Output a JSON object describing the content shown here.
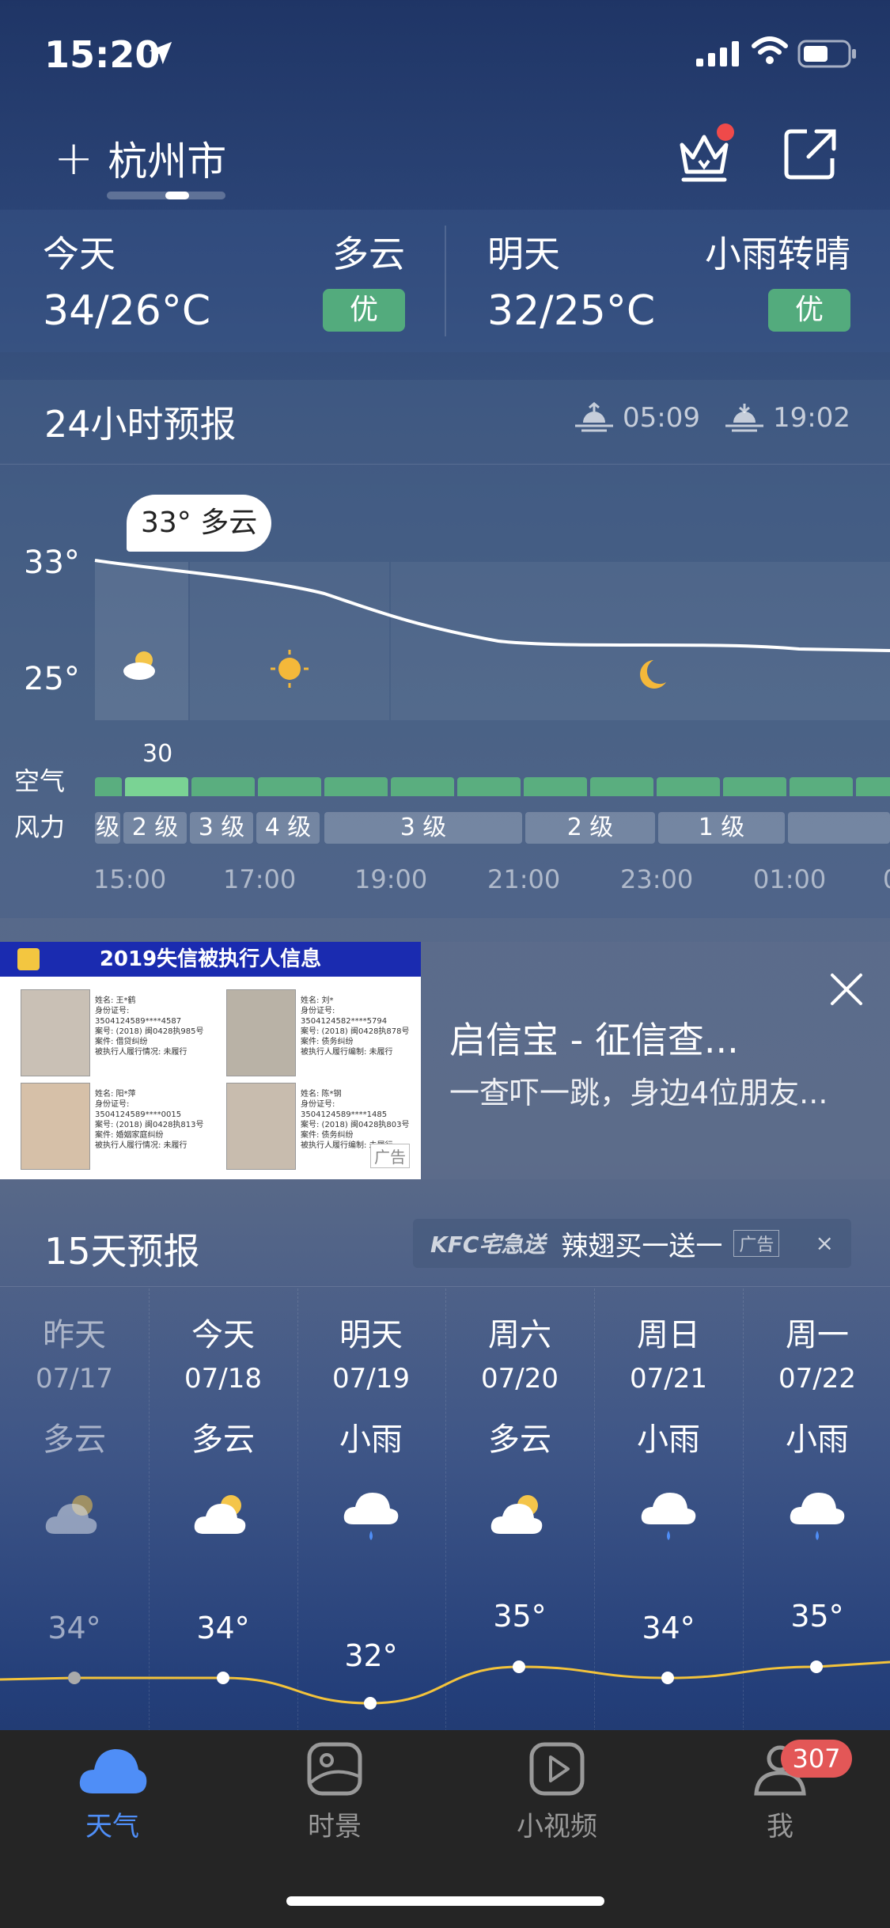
{
  "status": {
    "time": "15:20"
  },
  "header": {
    "city": "杭州市"
  },
  "today": {
    "label": "今天",
    "condition": "多云",
    "temp": "34/26°C",
    "aqi": "优"
  },
  "tomorrow": {
    "label": "明天",
    "condition": "小雨转晴",
    "temp": "32/25°C",
    "aqi": "优"
  },
  "forecast24": {
    "title": "24小时预报",
    "sunrise": "05:09",
    "sunset": "19:02",
    "high": "33°",
    "low": "25°",
    "tooltip": "33° 多云",
    "aqi_label": "空气",
    "wind_label": "风力",
    "aqi_value": "30",
    "winds": [
      "级",
      "2 级",
      "3 级",
      "4 级",
      "3 级",
      "2 级",
      "1 级",
      ""
    ],
    "hours": [
      "15:00",
      "17:00",
      "19:00",
      "21:00",
      "23:00",
      "01:00",
      "0"
    ],
    "colors": {
      "aqi_good": "#5aae7f",
      "aqi_selected": "#7ad394"
    }
  },
  "ad": {
    "image_title": "2019失信被执行人信息",
    "image_tag": "广告",
    "title": "启信宝 - 征信查...",
    "subtitle": "一查吓一跳，身边4位朋友...",
    "persons": [
      {
        "name": "姓名: 王*鹤",
        "id": "身份证号: 3504124589****4587",
        "case": "案号: (2018) 闽0428执985号",
        "type": "案件: 借贷纠纷",
        "status": "被执行人履行情况: 未履行"
      },
      {
        "name": "姓名: 刘*",
        "id": "身份证号: 3504124582****5794",
        "case": "案号: (2018) 闽0428执878号",
        "type": "案件: 债务纠纷",
        "status": "被执行人履行编制: 未履行"
      },
      {
        "name": "姓名: 阳*萍",
        "id": "身份证号: 3504124589****0015",
        "case": "案号: (2018) 闽0428执813号",
        "type": "案件: 婚姻家庭纠纷",
        "status": "被执行人履行情况: 未履行"
      },
      {
        "name": "姓名: 陈*钢",
        "id": "身份证号: 3504124589****1485",
        "case": "案号: (2018) 闽0428执803号",
        "type": "案件: 债务纠纷",
        "status": "被执行人履行编制: 未履行"
      }
    ]
  },
  "forecast15": {
    "title": "15天预报",
    "kfc_logo": "KFC宅急送",
    "kfc_text": "辣翅买一送一",
    "kfc_ad": "广告",
    "kfc_close": "×",
    "days": [
      {
        "wd": "昨天",
        "date": "07/17",
        "cond": "多云",
        "hi": "34°",
        "icon": "partly-cloudy-icon"
      },
      {
        "wd": "今天",
        "date": "07/18",
        "cond": "多云",
        "hi": "34°",
        "icon": "partly-cloudy-icon"
      },
      {
        "wd": "明天",
        "date": "07/19",
        "cond": "小雨",
        "hi": "32°",
        "icon": "rain-icon"
      },
      {
        "wd": "周六",
        "date": "07/20",
        "cond": "多云",
        "hi": "35°",
        "icon": "partly-cloudy-icon"
      },
      {
        "wd": "周日",
        "date": "07/21",
        "cond": "小雨",
        "hi": "34°",
        "icon": "rain-icon"
      },
      {
        "wd": "周一",
        "date": "07/22",
        "cond": "小雨",
        "hi": "35°",
        "icon": "rain-icon"
      }
    ]
  },
  "tabs": [
    {
      "label": "天气",
      "icon": "cloud-icon",
      "active": true
    },
    {
      "label": "时景",
      "icon": "scenery-icon"
    },
    {
      "label": "小视频",
      "icon": "play-icon"
    },
    {
      "label": "我",
      "icon": "user-icon"
    }
  ],
  "badge": "307",
  "colors": {
    "accent": "#4f8ef7",
    "aqi_badge": "#53ab7d",
    "temp_line": "#f3c33b",
    "badge": "#e35757"
  }
}
